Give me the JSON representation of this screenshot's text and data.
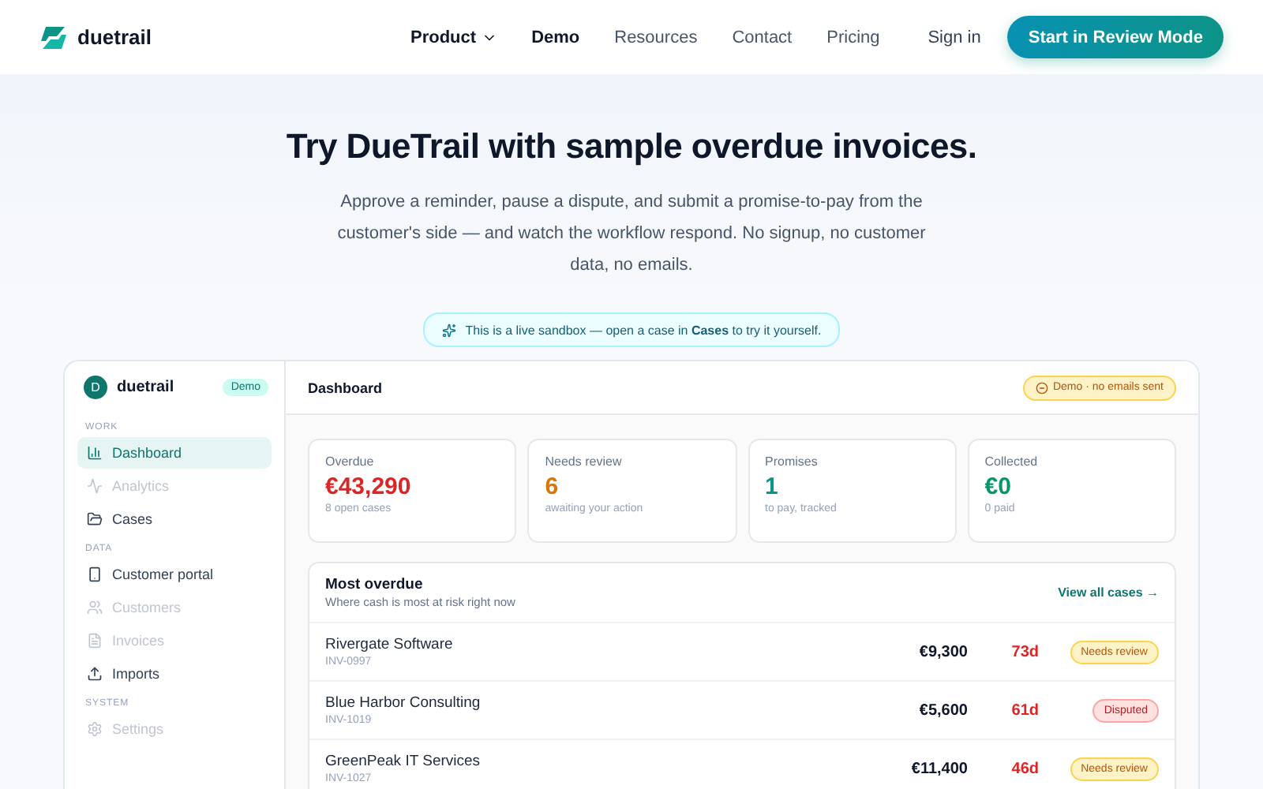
{
  "nav": {
    "brand": "duetrail",
    "links": [
      {
        "label": "Product",
        "dropdown": true,
        "selected": true
      },
      {
        "label": "Demo",
        "dropdown": false,
        "selected": true
      },
      {
        "label": "Resources",
        "dropdown": false,
        "selected": false
      },
      {
        "label": "Contact",
        "dropdown": false,
        "selected": false
      },
      {
        "label": "Pricing",
        "dropdown": false,
        "selected": false
      }
    ],
    "sign_in": "Sign in",
    "cta": "Start in Review Mode"
  },
  "hero": {
    "title": "Try DueTrail with sample overdue invoices.",
    "subtitle": "Approve a reminder, pause a dispute, and submit a promise-to-pay from the customer's side — and watch the workflow respond. No signup, no customer data, no emails.",
    "banner": "This is a live sandbox — open a case in **Cases** to try it yourself."
  },
  "app": {
    "sidebar": {
      "avatar": "D",
      "brand": "duetrail",
      "badge": "Demo",
      "sections": [
        {
          "title": "WORK",
          "items": [
            {
              "label": "Dashboard",
              "kind": "chart",
              "selected": true,
              "disabled": false
            },
            {
              "label": "Analytics",
              "kind": "pulse",
              "selected": false,
              "disabled": true
            },
            {
              "label": "Cases",
              "kind": "folder",
              "selected": false,
              "disabled": false
            }
          ]
        },
        {
          "title": "DATA",
          "items": [
            {
              "label": "Customer portal",
              "kind": "phone",
              "selected": false,
              "disabled": false
            },
            {
              "label": "Customers",
              "kind": "users",
              "selected": false,
              "disabled": true
            },
            {
              "label": "Invoices",
              "kind": "file",
              "selected": false,
              "disabled": true
            },
            {
              "label": "Imports",
              "kind": "upload",
              "selected": false,
              "disabled": false
            }
          ]
        },
        {
          "title": "SYSTEM",
          "items": [
            {
              "label": "Settings",
              "kind": "gear",
              "selected": false,
              "disabled": true
            }
          ]
        }
      ]
    },
    "header": {
      "title": "Dashboard",
      "notice": "Demo · no emails sent"
    },
    "stats": [
      {
        "label": "Overdue",
        "value": "€43,290",
        "note": "8 open cases",
        "color": "#dc2626"
      },
      {
        "label": "Needs review",
        "value": "6",
        "note": "awaiting your action",
        "color": "#d97706"
      },
      {
        "label": "Promises",
        "value": "1",
        "note": "to pay, tracked",
        "color": "#0d9488"
      },
      {
        "label": "Collected",
        "value": "€0",
        "note": "0 paid",
        "color": "#059669"
      }
    ],
    "table": {
      "title": "Most overdue",
      "subtitle": "Where cash is most at risk right now",
      "link": "View all cases →",
      "rows": [
        {
          "customer": "Rivergate Software",
          "invoice": "INV-0997",
          "amount": "€9,300",
          "age": "73d",
          "status": "Needs review",
          "kind": "review"
        },
        {
          "customer": "Blue Harbor Consulting",
          "invoice": "INV-1019",
          "amount": "€5,600",
          "age": "61d",
          "status": "Disputed",
          "kind": "disputed"
        },
        {
          "customer": "GreenPeak IT Services",
          "invoice": "INV-1027",
          "amount": "€11,400",
          "age": "46d",
          "status": "Needs review",
          "kind": "review"
        }
      ]
    }
  }
}
